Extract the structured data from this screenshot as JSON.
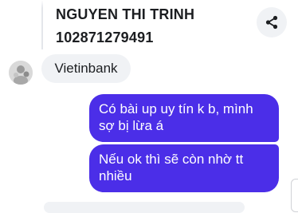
{
  "shared_card": {
    "name": "NGUYEN THI TRINH",
    "account_number": "102871279491"
  },
  "icons": {
    "share": "share-icon",
    "avatar": "avatar"
  },
  "messages": [
    {
      "direction": "incoming",
      "text": "Vietinbank"
    },
    {
      "direction": "outgoing",
      "text": "Có bài up uy tín k b, mình\nsợ bị lừa á"
    },
    {
      "direction": "outgoing",
      "text": "Nếu ok thì sẽ còn nhờ tt\nnhiều"
    }
  ],
  "colors": {
    "outgoing_bubble": "#4b2ee8",
    "incoming_bubble": "#f0f2f5",
    "page_background": "#ffffff"
  }
}
